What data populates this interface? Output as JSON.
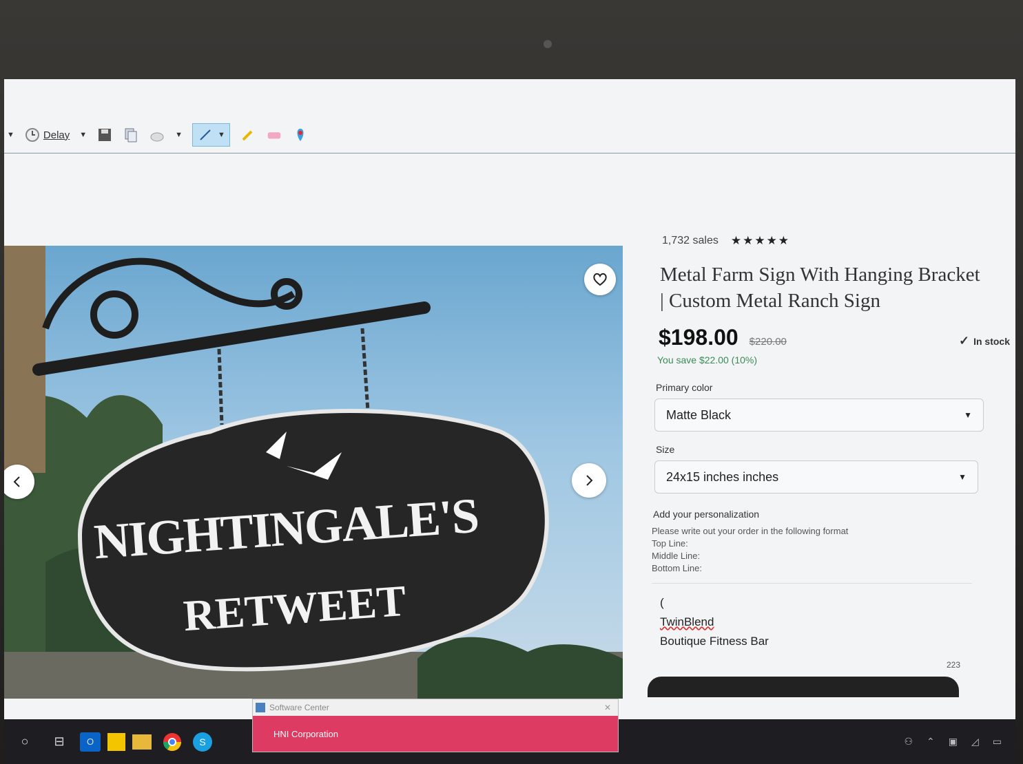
{
  "toolbar": {
    "delay_label": "Delay"
  },
  "product": {
    "sales": "1,732 sales",
    "stars": "★★★★★",
    "rating": 5,
    "title_line1": "Metal Farm Sign With Hanging Bracket",
    "title_line2": "| Custom Metal Ranch Sign",
    "price": "$198.00",
    "original_price": "$220.00",
    "stock": "In stock",
    "savings": "You save $22.00 (10%)",
    "primary_color_label": "Primary color",
    "primary_color_value": "Matte Black",
    "size_label": "Size",
    "size_value": "24x15 inches inches",
    "personalization_label": "Add your personalization",
    "instructions": {
      "line1": "Please write out your order in the following format",
      "line2": "Top Line:",
      "line3": "Middle Line:",
      "line4": "Bottom Line:"
    },
    "personalization_text": {
      "line1": "(",
      "line2": "TwinBlend",
      "line3": "Boutique Fitness Bar"
    },
    "char_count": "223"
  },
  "sign": {
    "line1": "NIGHTINGALE'S",
    "line2": "RETWEET"
  },
  "popup": {
    "title": "Software Center",
    "body": "HNI Corporation"
  },
  "colors": {
    "accent_savings": "#3a8a56",
    "popup_red": "#dd3b62"
  }
}
